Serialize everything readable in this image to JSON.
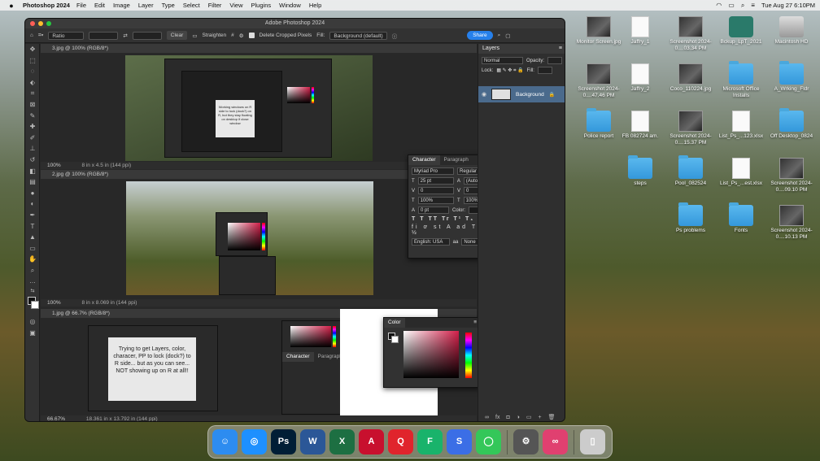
{
  "menubar": {
    "app_name": "Photoshop 2024",
    "items": [
      "File",
      "Edit",
      "Image",
      "Layer",
      "Type",
      "Select",
      "Filter",
      "View",
      "Plugins",
      "Window",
      "Help"
    ],
    "datetime": "Tue Aug 27  6:10PM"
  },
  "ps": {
    "window_title": "Adobe Photoshop 2024",
    "options": {
      "ratio": "Ratio",
      "clear": "Clear",
      "straighten": "Straighten",
      "delete_cropped": "Delete Cropped Pixels",
      "fill_label": "Fill:",
      "fill_value": "Background (default)",
      "share": "Share"
    },
    "docs": [
      {
        "tab": "3.jpg @ 100% (RGB/8*)",
        "zoom": "100%",
        "size": "8 in x 4.5 in (144 ppi)"
      },
      {
        "tab": "2.jpg @ 100% (RGB/8*)",
        "zoom": "100%",
        "size": "8 in x 8.069 in (144 ppi)"
      },
      {
        "tab": "1.jpg @ 66.7% (RGB/8*)",
        "zoom": "66.67%",
        "size": "18.361 in x 13.792 in (144 ppi)"
      }
    ],
    "note_small": "Working windows on R side to lock (dock?) on R, but they stay floating on desktop if close window",
    "note_large": "Trying to get Layers, color, characer, PP to lock (dock?) to R side... but as you can see... NOT showing up on R at all!!",
    "layers": {
      "title": "Layers",
      "kind": "Normal",
      "opacity": "Opacity:",
      "lock": "Lock:",
      "fill": "Fill:",
      "layer_name": "Background"
    },
    "character": {
      "tab1": "Character",
      "tab2": "Paragraph",
      "font": "Myriad Pro",
      "style": "Regular",
      "size": "25 pt",
      "leading": "(Auto)",
      "kerning": "0",
      "tracking": "0",
      "vscale": "100%",
      "hscale": "100%",
      "baseline": "0 pt",
      "color_label": "Color:",
      "language": "English: USA",
      "aa": "None"
    },
    "color_panel": {
      "title": "Color"
    },
    "colors": {
      "accent": "#2680eb",
      "layer_selected": "#4a6a8c",
      "color_fg": "#d4204a"
    }
  },
  "desktop": {
    "icons": [
      {
        "label": "Monitor Screen.jpg",
        "type": "shot"
      },
      {
        "label": "Jaffry_1",
        "type": "doc"
      },
      {
        "label": "Screenshot 2024-0....03.34 PM",
        "type": "shot"
      },
      {
        "label": "Bckup_LpT_2021",
        "type": "tm"
      },
      {
        "label": "Macintosh HD",
        "type": "drive"
      },
      {
        "label": "Screenshot 2024-0....47.46 PM",
        "type": "shot"
      },
      {
        "label": "Jaffry_2",
        "type": "doc"
      },
      {
        "label": "Coco_110224.jpg",
        "type": "shot"
      },
      {
        "label": "Microsoft Office Installs",
        "type": "folder"
      },
      {
        "label": "A_Wrking_Fldr",
        "type": "folder"
      },
      {
        "label": "Police report",
        "type": "folder"
      },
      {
        "label": "FB 082724 am.",
        "type": "doc"
      },
      {
        "label": "Screenshot 2024-0....15.37 PM",
        "type": "shot"
      },
      {
        "label": "List_Ps_...123.xlsx",
        "type": "doc"
      },
      {
        "label": "Off Desktop_0824",
        "type": "folder"
      },
      {
        "label": "steps",
        "type": "folder"
      },
      {
        "label": "Pool_082524",
        "type": "folder"
      },
      {
        "label": "List_Ps_...est.xlsx",
        "type": "doc"
      },
      {
        "label": "Screenshot 2024-0....09.10 PM",
        "type": "shot"
      },
      {
        "label": "Ps problems",
        "type": "folder"
      },
      {
        "label": "Fonts",
        "type": "folder"
      },
      {
        "label": "Screenshot 2024-0....10.13 PM",
        "type": "shot"
      }
    ]
  },
  "dock": {
    "apps": [
      {
        "name": "finder-app",
        "glyph": "☺",
        "color": "#2d8cf0"
      },
      {
        "name": "safari-app",
        "glyph": "◎",
        "color": "#1e90ff"
      },
      {
        "name": "photoshop-app",
        "glyph": "Ps",
        "color": "#001e36"
      },
      {
        "name": "word-app",
        "glyph": "W",
        "color": "#2b5797"
      },
      {
        "name": "excel-app",
        "glyph": "X",
        "color": "#1d6f42"
      },
      {
        "name": "acrobat-app",
        "glyph": "A",
        "color": "#c8102e"
      },
      {
        "name": "acrobat-reader-app",
        "glyph": "Q",
        "color": "#e0242c"
      },
      {
        "name": "feather-app",
        "glyph": "F",
        "color": "#19b36b"
      },
      {
        "name": "shortcut-app",
        "glyph": "S",
        "color": "#3b6ee6"
      },
      {
        "name": "messages-app",
        "glyph": "◯",
        "color": "#34c759"
      },
      {
        "name": "settings-app",
        "glyph": "⚙",
        "color": "#555"
      },
      {
        "name": "creative-cloud-app",
        "glyph": "∞",
        "color": "#e04070"
      },
      {
        "name": "trash-app",
        "glyph": "▯",
        "color": "#ccc"
      }
    ]
  }
}
